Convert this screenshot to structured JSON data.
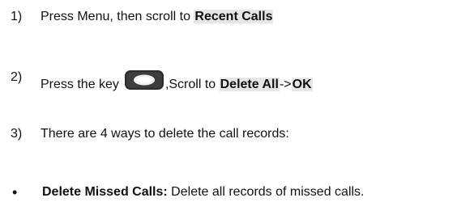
{
  "steps": [
    {
      "number": "1)",
      "text": "Press Menu, then scroll to ",
      "highlight": "Recent Calls"
    },
    {
      "number": "2)",
      "text_before": "Press the key",
      "key_icon": "oval-key-icon",
      "text_after": ",Scroll to ",
      "highlight1": "Delete All",
      "arrow": "->",
      "highlight2": "OK"
    },
    {
      "number": "3)",
      "text": "There are 4 ways to delete the call records:"
    }
  ],
  "bullets": [
    {
      "symbol": "•",
      "label": "Delete Missed Calls:",
      "text": " Delete all records of missed calls."
    }
  ],
  "colors": {
    "highlight_bg": "#e6e6e6",
    "text": "#111111",
    "key_dark": "#2b2b2b"
  }
}
